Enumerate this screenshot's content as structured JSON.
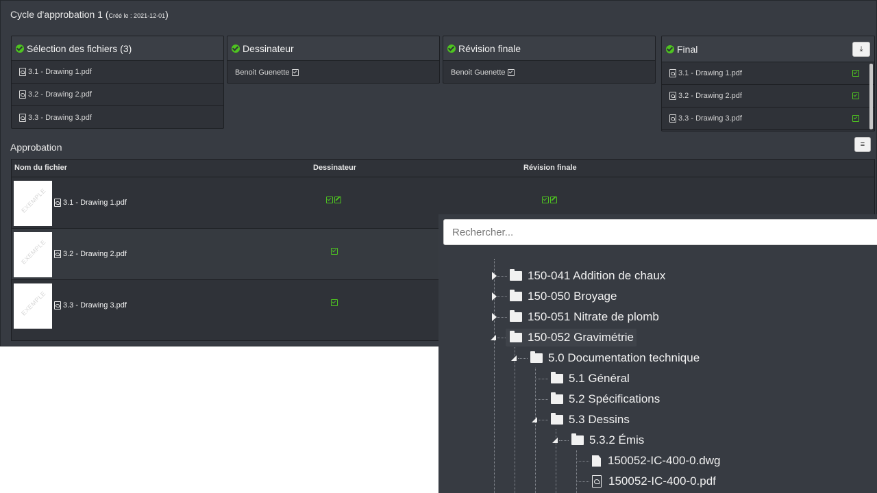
{
  "cycle": {
    "title": "Cycle d'approbation 1",
    "created_prefix": "(",
    "created_label": "Créé le : 2021-12-01",
    "created_suffix": ")"
  },
  "selection_card": {
    "title": "Sélection des fichiers (3)",
    "files": [
      "3.1 - Drawing 1.pdf",
      "3.2 - Drawing 2.pdf",
      "3.3 - Drawing 3.pdf"
    ]
  },
  "dessinateur_card": {
    "title": "Dessinateur",
    "user": "Benoit Guenette"
  },
  "revision_card": {
    "title": "Révision finale",
    "user": "Benoit Guenette"
  },
  "final_card": {
    "title": "Final",
    "download_icon": "download-icon",
    "files": [
      "3.1 - Drawing 1.pdf",
      "3.2 - Drawing 2.pdf",
      "3.3 - Drawing 3.pdf"
    ]
  },
  "approbation": {
    "title": "Approbation",
    "menu_icon": "bars-icon",
    "columns": [
      "Nom du fichier",
      "Dessinateur",
      "Révision finale"
    ],
    "watermark": "EXEMPLE",
    "rows": [
      {
        "file": "3.1 - Drawing 1.pdf"
      },
      {
        "file": "3.2 - Drawing 2.pdf"
      },
      {
        "file": "3.3 - Drawing 3.pdf"
      }
    ]
  },
  "search": {
    "placeholder": "Rechercher..."
  },
  "tree": {
    "items": [
      "150-041 Addition de chaux",
      "150-050 Broyage",
      "150-051 Nitrate de plomb",
      "150-052 Gravimétrie",
      "5.0 Documentation technique",
      "5.1 Général",
      "5.2 Spécifications",
      "5.3 Dessins",
      "5.3.2 Émis",
      "150052-IC-400-0.dwg",
      "150052-IC-400-0.pdf"
    ]
  },
  "colors": {
    "accent_green": "#4ec420",
    "panel_bg": "#373b42"
  }
}
